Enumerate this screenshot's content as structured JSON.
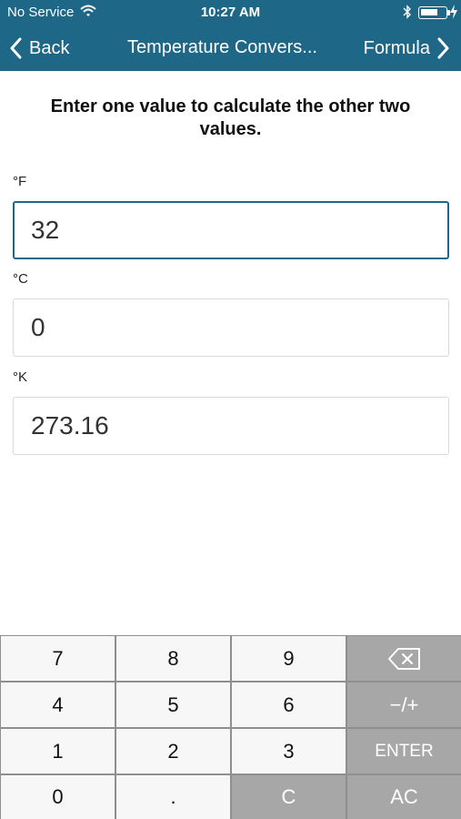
{
  "status_bar": {
    "carrier": "No Service",
    "time": "10:27 AM"
  },
  "nav": {
    "back_label": "Back",
    "title": "Temperature Convers...",
    "formula_label": "Formula"
  },
  "instructions": "Enter one value to calculate the other two values.",
  "fields": [
    {
      "label": "°F",
      "value": "32"
    },
    {
      "label": "°C",
      "value": "0"
    },
    {
      "label": "°K",
      "value": "273.16"
    }
  ],
  "keypad": {
    "row1": [
      "7",
      "8",
      "9"
    ],
    "row2": [
      "4",
      "5",
      "6",
      "−/+"
    ],
    "row3": [
      "1",
      "2",
      "3",
      "ENTER"
    ],
    "row4": [
      "0",
      ".",
      "C",
      "AC"
    ],
    "backspace_icon": "backspace-icon"
  },
  "colors": {
    "nav_background": "#1e6786",
    "focus_border": "#1e6786",
    "function_key": "#a7a7a7"
  }
}
